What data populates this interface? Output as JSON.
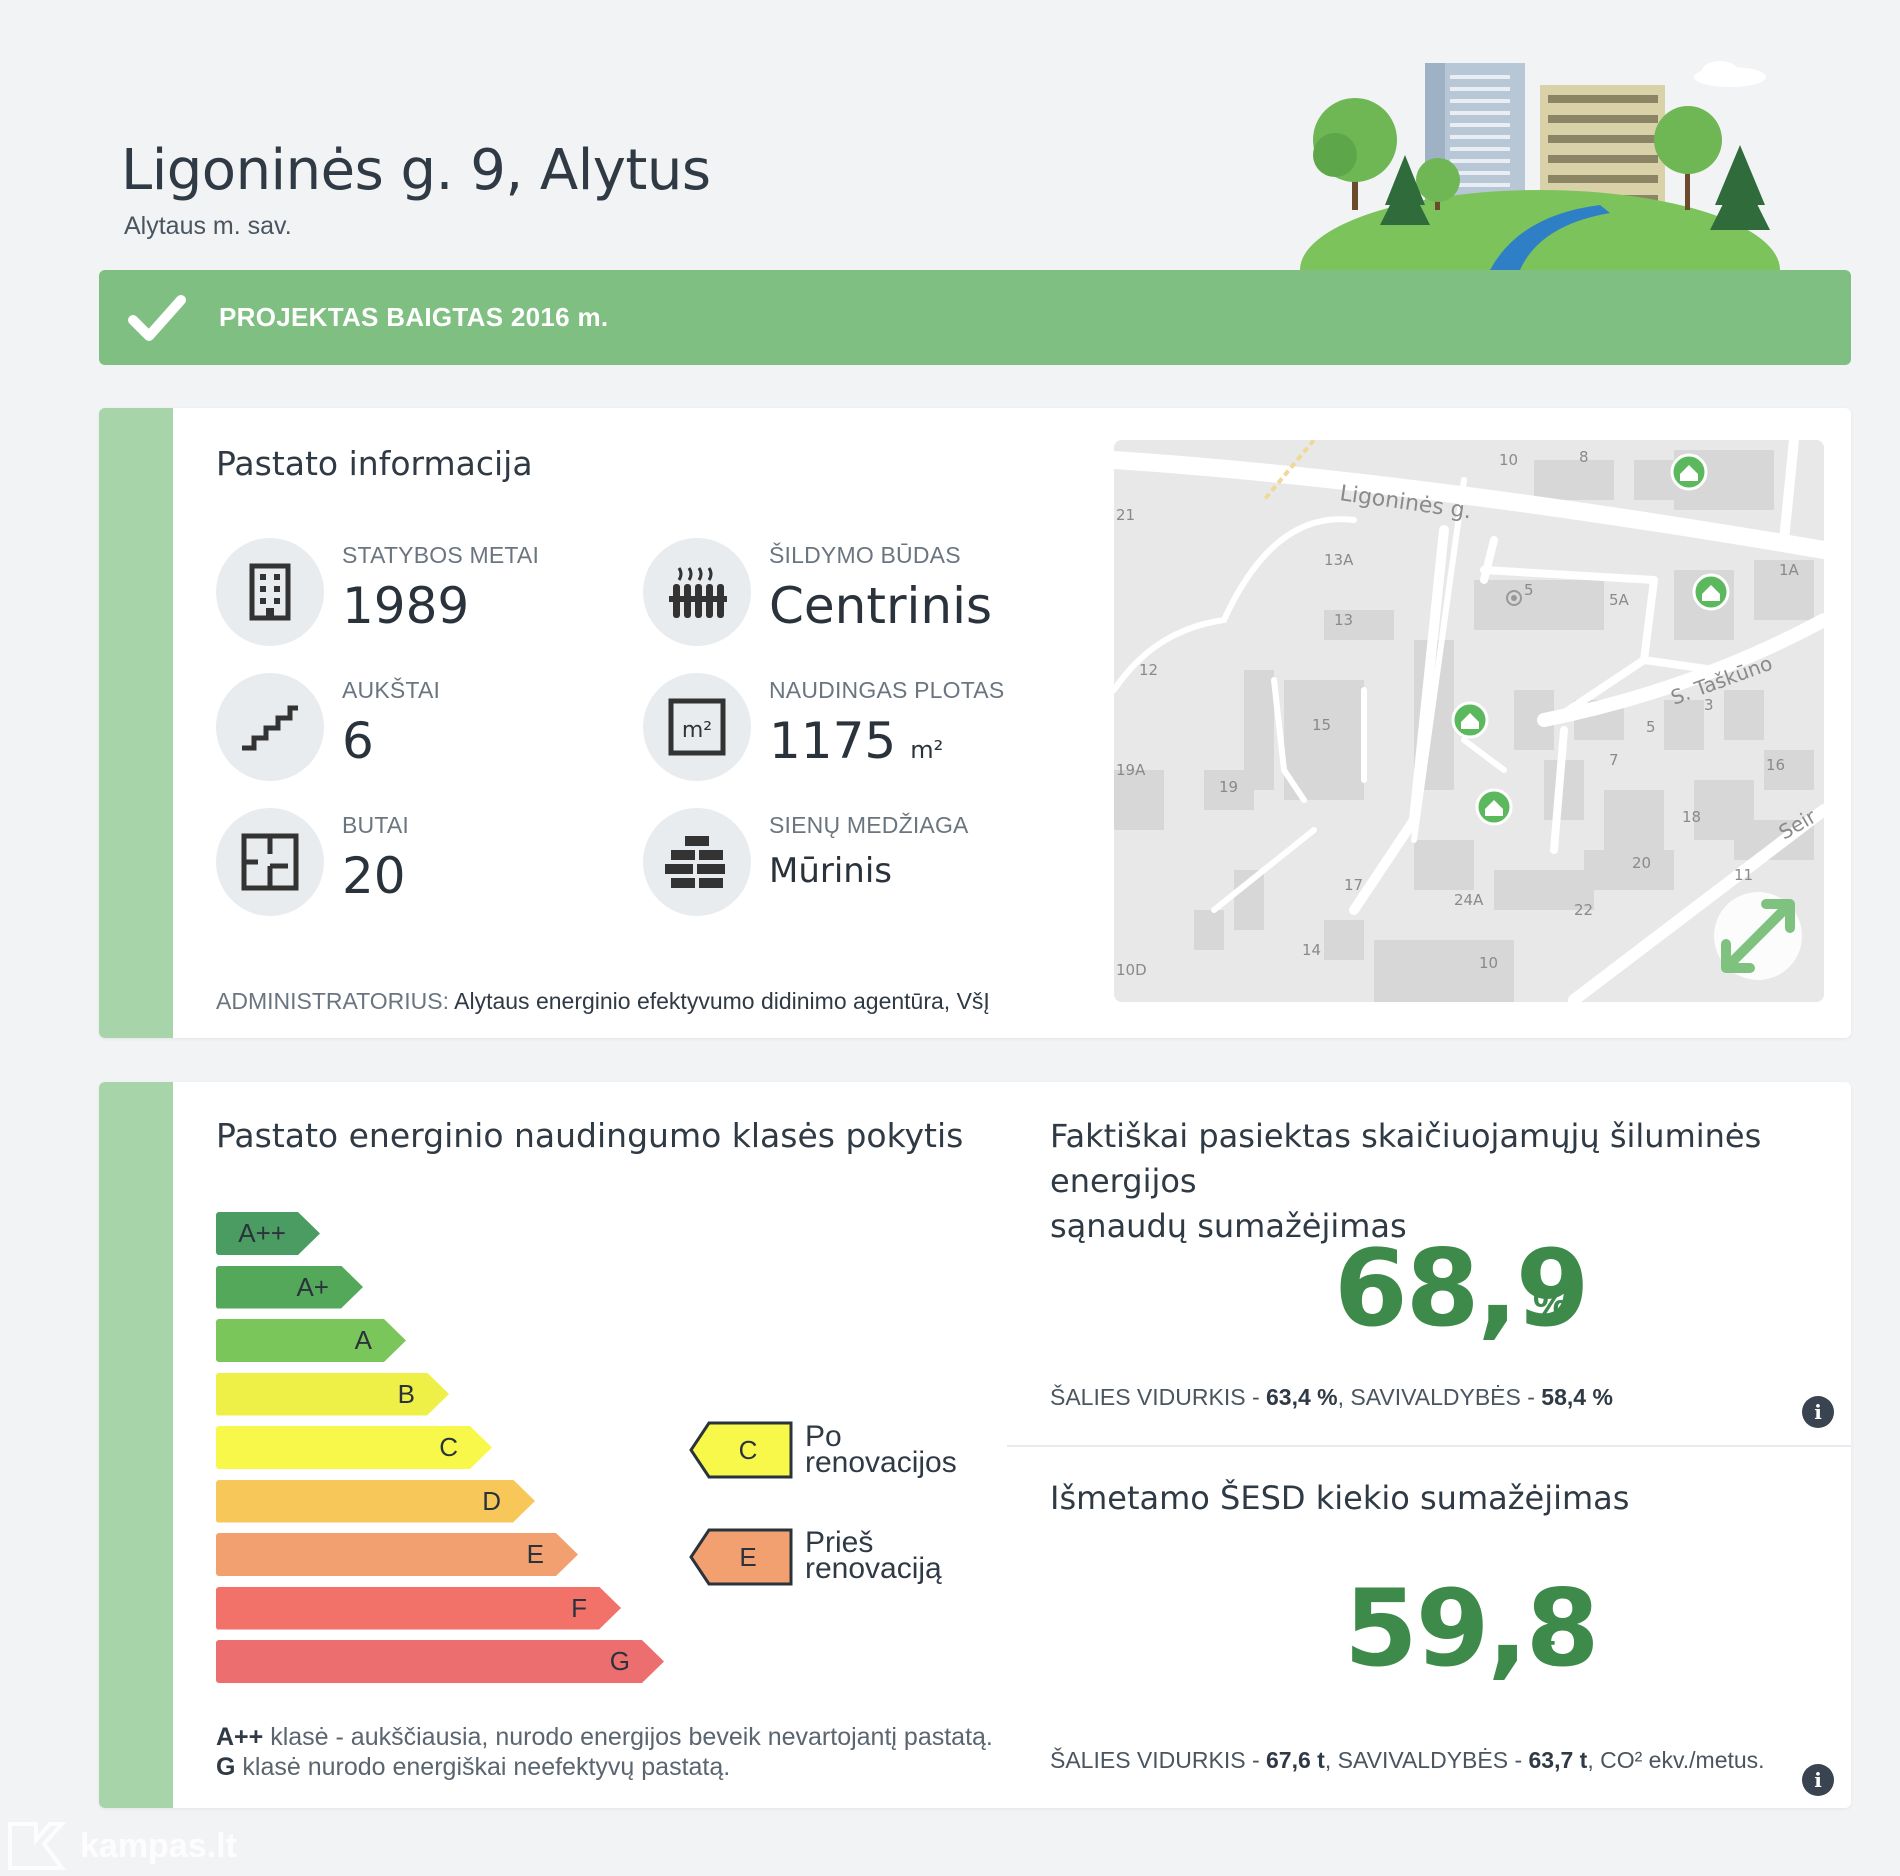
{
  "header": {
    "title": "Ligoninės g. 9, Alytus",
    "subtitle": "Alytaus m. sav."
  },
  "banner": {
    "text": "PROJEKTAS BAIGTAS 2016 m.",
    "color": "#7fbf82"
  },
  "building_info": {
    "section_title": "Pastato informacija",
    "items": [
      {
        "label": "STATYBOS METAI",
        "value": "1989",
        "icon": "building-icon"
      },
      {
        "label": "ŠILDYMO BŪDAS",
        "value": "Centrinis",
        "icon": "radiator-icon"
      },
      {
        "label": "AUKŠTAI",
        "value": "6",
        "icon": "stairs-icon"
      },
      {
        "label": "NAUDINGAS PLOTAS",
        "value": "1175",
        "unit": "m²",
        "icon": "area-icon"
      },
      {
        "label": "BUTAI",
        "value": "20",
        "icon": "floorplan-icon"
      },
      {
        "label": "SIENŲ MEDŽIAGA",
        "value": "Mūrinis",
        "icon": "bricks-icon"
      }
    ],
    "admin_label": "ADMINISTRATORIUS:",
    "admin_value": "Alytaus energinio efektyvumo didinimo agentūra, VšĮ"
  },
  "map": {
    "street_labels": [
      "Ligoninės g.",
      "S. Taškūno",
      "Seir"
    ],
    "house_numbers": [
      "10",
      "8",
      "21",
      "13A",
      "5",
      "5A",
      "1A",
      "13",
      "12",
      "15",
      "3",
      "5",
      "7",
      "16",
      "19A",
      "19",
      "18",
      "17",
      "20",
      "11",
      "24A",
      "22",
      "14",
      "10D",
      "10"
    ]
  },
  "energy_class": {
    "section_title": "Pastato energinio naudingumo klasės pokytis",
    "classes": [
      {
        "label": "A++",
        "color": "#4b9c62"
      },
      {
        "label": "A+",
        "color": "#54a85a"
      },
      {
        "label": "A",
        "color": "#7bc65a"
      },
      {
        "label": "B",
        "color": "#eef047"
      },
      {
        "label": "C",
        "color": "#f8f84b"
      },
      {
        "label": "D",
        "color": "#f8c75a"
      },
      {
        "label": "E",
        "color": "#f3a070"
      },
      {
        "label": "F",
        "color": "#f2726a"
      },
      {
        "label": "G",
        "color": "#ec6e6e"
      }
    ],
    "after": {
      "class": "C",
      "label_line1": "Po",
      "label_line2": "renovacijos"
    },
    "before": {
      "class": "E",
      "label_line1": "Prieš",
      "label_line2": "renovaciją"
    },
    "note_line1_bold": "A++",
    "note_line1": "klasė - aukščiausia, nurodo energijos beveik nevartojantį pastatą.",
    "note_line2_bold": "G",
    "note_line2": "klasė nurodo energiškai neefektyvų pastatą."
  },
  "energy_saving": {
    "title_line1": "Faktiškai pasiektas skaičiuojamųjų šiluminės energijos",
    "title_line2": "sąnaudų sumažėjimas",
    "value": "68,9",
    "unit": "%",
    "avg_country_label": "ŠALIES VIDURKIS - ",
    "avg_country": "63,4 %",
    "avg_muni_label": ", SAVIVALDYBĖS - ",
    "avg_muni": "58,4 %"
  },
  "emission": {
    "title": "Išmetamo ŠESD kiekio sumažėjimas",
    "value": "59,8",
    "unit": "t",
    "avg_country_label": "ŠALIES VIDURKIS - ",
    "avg_country": "67,6 t",
    "avg_muni_label": ", SAVIVALDYBĖS - ",
    "avg_muni": "63,7 t",
    "avg_suffix": ", CO² ekv./metus."
  },
  "info_icon_glyph": "i",
  "watermark": "kampas.lt"
}
